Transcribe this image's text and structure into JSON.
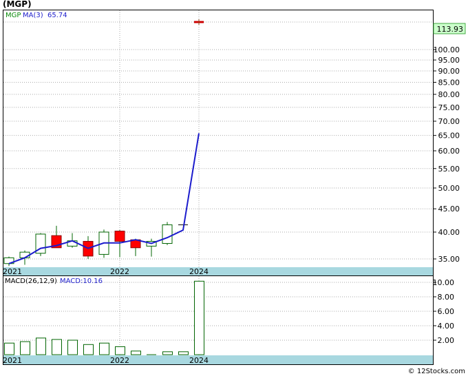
{
  "header": {
    "ticker": "(MGP)",
    "legend_symbol": "MGP",
    "legend_ma_label": "MA(3)",
    "legend_ma_value": "65.74"
  },
  "macd_panel": {
    "label": "MACD(26,12,9)",
    "value_label": "MACD:10.16"
  },
  "footer": {
    "credit": "© 12Stocks.com"
  },
  "colors": {
    "up_candle": "#ffffff",
    "down_candle": "#ff0000",
    "candle_border": "#006400",
    "ma_line": "#1a1acc",
    "macd_bar": "#ffffff",
    "macd_border": "#006400",
    "date_band": "#a8d8e0",
    "price_tag": "#ccffcc"
  },
  "chart_data": [
    {
      "type": "candlestick",
      "title": "(MGP)",
      "price_tag": "113.93",
      "y_ticks": [
        "100.00",
        "95.00",
        "90.00",
        "85.00",
        "80.00",
        "75.00",
        "70.00",
        "65.00",
        "60.00",
        "55.00",
        "50.00",
        "45.00",
        "40.00",
        "35.00"
      ],
      "x_tick_labels": [
        "2021",
        "2022",
        "2024"
      ],
      "candles": [
        {
          "open": 34.2,
          "high": 35.4,
          "low": 33.8,
          "close": 35.2
        },
        {
          "open": 35.2,
          "high": 36.5,
          "low": 34.0,
          "close": 36.2
        },
        {
          "open": 36.0,
          "high": 39.8,
          "low": 35.5,
          "close": 39.6
        },
        {
          "open": 39.3,
          "high": 41.3,
          "low": 37.0,
          "close": 37.0
        },
        {
          "open": 37.3,
          "high": 39.8,
          "low": 37.0,
          "close": 38.3
        },
        {
          "open": 38.2,
          "high": 39.2,
          "low": 35.0,
          "close": 35.5
        },
        {
          "open": 35.8,
          "high": 40.5,
          "low": 35.2,
          "close": 40.0
        },
        {
          "open": 40.2,
          "high": 40.4,
          "low": 35.3,
          "close": 38.2
        },
        {
          "open": 38.5,
          "high": 38.7,
          "low": 35.5,
          "close": 37.0
        },
        {
          "open": 37.3,
          "high": 38.7,
          "low": 35.4,
          "close": 38.2
        },
        {
          "open": 37.8,
          "high": 42.1,
          "low": 37.5,
          "close": 41.5
        },
        {
          "open": 41.5,
          "high": 41.5,
          "low": 41.5,
          "close": 41.5
        },
        {
          "open": 113.93,
          "high": 114.2,
          "low": 113.6,
          "close": 113.93
        }
      ],
      "ma_line": [
        34.2,
        35.2,
        36.9,
        37.4,
        38.3,
        36.9,
        37.9,
        37.9,
        38.5,
        37.8,
        38.9,
        40.4,
        65.74
      ]
    },
    {
      "type": "bar",
      "title": "MACD(26,12,9)",
      "y_ticks": [
        "10.00",
        "8.00",
        "6.00",
        "4.00",
        "2.00"
      ],
      "x_tick_labels": [
        "2021",
        "2022",
        "2024"
      ],
      "values": [
        1.6,
        1.8,
        2.3,
        2.1,
        2.0,
        1.4,
        1.6,
        1.1,
        0.5,
        0.0,
        0.4,
        0.4,
        10.16
      ]
    }
  ]
}
